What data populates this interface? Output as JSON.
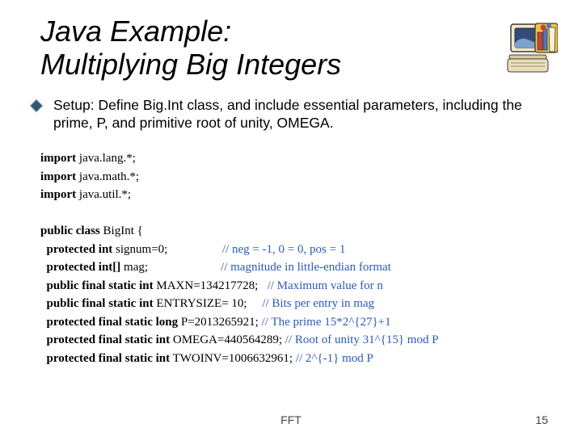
{
  "title": {
    "line1": "Java Example:",
    "line2": "Multiplying Big Integers"
  },
  "bullet": "Setup: Define Big.Int class, and include essential parameters, including the prime, P, and primitive root of unity, OMEGA.",
  "code": {
    "l1": {
      "kw": "import",
      "rest": "java.lang.*;"
    },
    "l2": {
      "kw": "import",
      "rest": "java.math.*;"
    },
    "l3": {
      "kw": "import",
      "rest": "java.util.*;"
    },
    "l5": {
      "kw": "public class",
      "rest": "BigInt {"
    },
    "l6": {
      "kw": "protected int",
      "rest": "signum=0;",
      "cm": "// neg = -1, 0 = 0, pos = 1"
    },
    "l7": {
      "kw": "protected int[]",
      "rest": "mag;",
      "cm": "// magnitude in little-endian format"
    },
    "l8": {
      "kw": "public final static int",
      "rest": "MAXN=134217728;",
      "cm": "// Maximum value for n"
    },
    "l9": {
      "kw": "public final static int",
      "rest": "ENTRYSIZE= 10;",
      "cm": "// Bits per entry in mag"
    },
    "l10": {
      "kw": "protected final static long",
      "rest": "P=2013265921;",
      "cm": "// The prime 15*2^{27}+1"
    },
    "l11": {
      "kw": "protected final static int",
      "rest": "OMEGA=440564289;",
      "cm": "// Root of unity 31^{15} mod P"
    },
    "l12": {
      "kw": "protected final static int",
      "rest": "TWOINV=1006632961;",
      "cm": "// 2^{-1} mod P"
    }
  },
  "footer": {
    "label": "FFT",
    "page": "15"
  }
}
